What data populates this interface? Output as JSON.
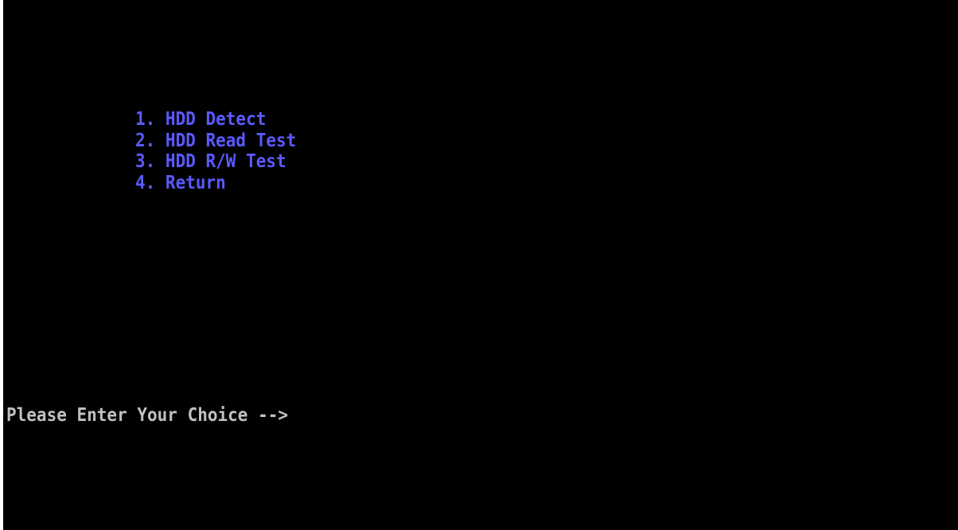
{
  "colors": {
    "background": "#000000",
    "menu_text": "#5a5aff",
    "prompt_text": "#c0c0c0"
  },
  "menu": {
    "items": [
      {
        "label": "1. HDD Detect"
      },
      {
        "label": "2. HDD Read Test"
      },
      {
        "label": "3. HDD R/W Test"
      },
      {
        "label": "4. Return"
      }
    ]
  },
  "prompt": {
    "text": "Please Enter Your Choice -->",
    "input_value": ""
  }
}
